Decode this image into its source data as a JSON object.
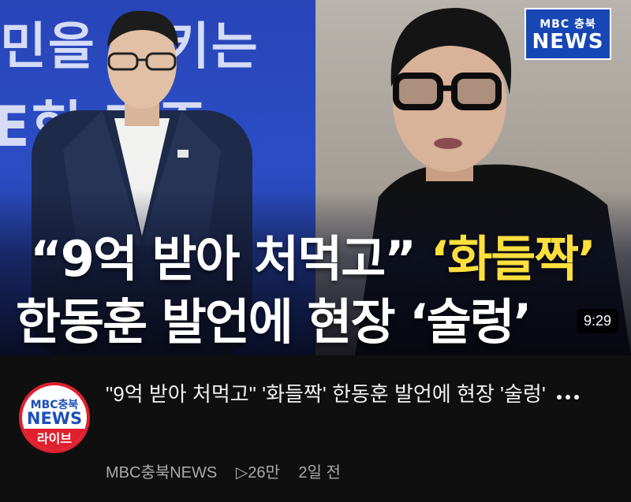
{
  "thumbnail": {
    "bg_text_line1": "민을 키키는",
    "bg_text_line2": "E헌 쟤주",
    "headline_quote_open": "“9억 받아 처먹고”",
    "headline_highlight": "‘화들짝’",
    "headline_line2": "한동훈 발언에 현장 ‘술렁’",
    "logo_top": "MBC 충북",
    "logo_news": "NEWS",
    "duration": "9:29",
    "colors": {
      "highlight": "#ffdf3d",
      "logo_bg": "#1747b5",
      "left_panel": "#2845b8"
    }
  },
  "channel": {
    "avatar_mbc": "MBC충북",
    "avatar_news": "NEWS",
    "avatar_live": "라이브",
    "name": "MBC충북NEWS"
  },
  "video": {
    "title": "\"9억 받아 처먹고\" '화들짝' 한동훈 발언에 현장 '술렁'",
    "views": "▷26만",
    "age": "2일 전"
  },
  "menu_icon": "more-vert-icon"
}
